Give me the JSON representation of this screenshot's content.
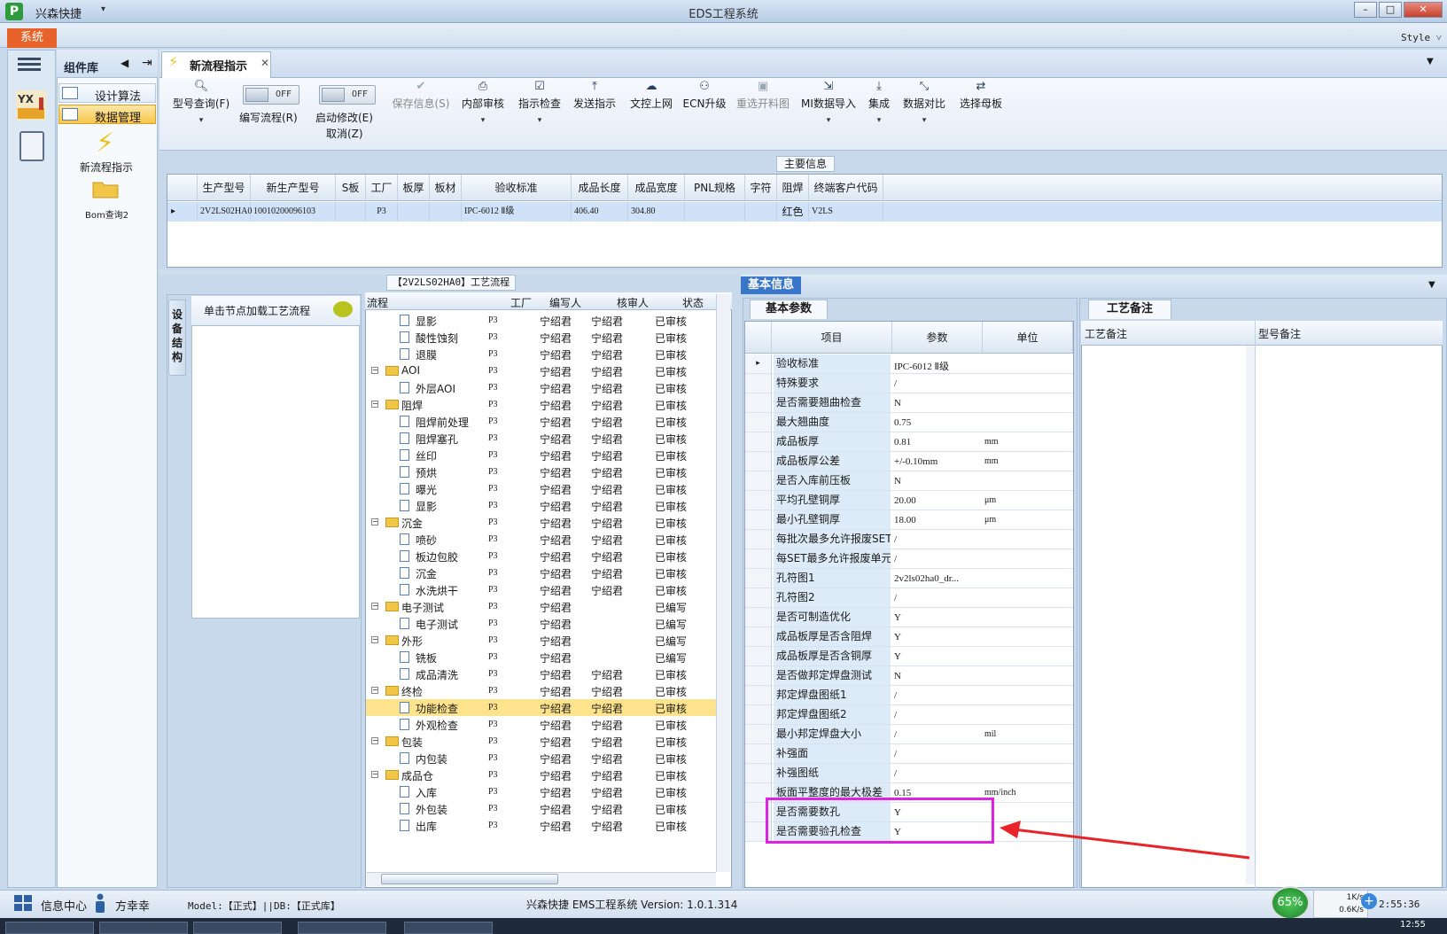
{
  "window": {
    "app_name": "兴森快捷",
    "title": "EDS工程系统",
    "minimize": "–",
    "maximize": "□",
    "close": "✕"
  },
  "menu": {
    "system_tab": "系统",
    "style_label": "Style ˅"
  },
  "component_library": {
    "title": "组件库",
    "items": [
      {
        "label": "设计算法",
        "selected": false
      },
      {
        "label": "数据管理",
        "selected": true
      }
    ],
    "new_flow_label": "新流程指示",
    "bom_label": "Bom查询2"
  },
  "doc_tab": {
    "label": "新流程指示",
    "close": "✕"
  },
  "toolbar": {
    "model_query": "型号查询(F)",
    "edit_flow_toggle": "OFF",
    "edit_flow": "编写流程(R)",
    "start_modify_toggle": "OFF",
    "start_modify": "启动修改(E)",
    "cancel": "取消(Z)",
    "save_info": "保存信息(S)",
    "internal_review": "内部审核",
    "instruction_check": "指示检查",
    "send_instruction": "发送指示",
    "upload_doc": "文控上网",
    "ecn_upgrade": "ECN升级",
    "reselect_cut": "重选开料图",
    "mi_import": "MI数据导入",
    "integrate": "集成",
    "data_compare": "数据对比",
    "select_mother": "选择母板"
  },
  "main_info": {
    "legend": "主要信息",
    "columns": [
      "生产型号",
      "新生产型号",
      "S板",
      "工厂",
      "板厚",
      "板材",
      "验收标准",
      "成品长度",
      "成品宽度",
      "PNL规格",
      "字符",
      "阻焊",
      "终端客户代码"
    ],
    "row": {
      "prod_model": "2V2LS02HA0",
      "new_prod_model": "10010200096103",
      "s_board": "",
      "factory": "P3",
      "thickness": "",
      "material": "",
      "standard": "IPC-6012 Ⅱ级",
      "length": "406.40",
      "width": "304.80",
      "pnl": "",
      "char": "",
      "solder_mask": "红色",
      "customer_code": "V2LS"
    }
  },
  "device_panel": {
    "vertical_tab": "设备结构",
    "hint": "单击节点加载工艺流程"
  },
  "process": {
    "legend": "【2V2LS02HA0】工艺流程",
    "columns": [
      "流程",
      "工厂",
      "编写人",
      "核审人",
      "状态"
    ],
    "rows": [
      {
        "name": "显影",
        "level": 2,
        "factory": "P3",
        "writer": "宁绍君",
        "reviewer": "宁绍君",
        "status": "已审核"
      },
      {
        "name": "酸性蚀刻",
        "level": 2,
        "factory": "P3",
        "writer": "宁绍君",
        "reviewer": "宁绍君",
        "status": "已审核"
      },
      {
        "name": "退膜",
        "level": 2,
        "factory": "P3",
        "writer": "宁绍君",
        "reviewer": "宁绍君",
        "status": "已审核"
      },
      {
        "name": "AOI",
        "level": 1,
        "factory": "P3",
        "writer": "宁绍君",
        "reviewer": "宁绍君",
        "status": "已审核"
      },
      {
        "name": "外层AOI",
        "level": 2,
        "factory": "P3",
        "writer": "宁绍君",
        "reviewer": "宁绍君",
        "status": "已审核"
      },
      {
        "name": "阻焊",
        "level": 1,
        "factory": "P3",
        "writer": "宁绍君",
        "reviewer": "宁绍君",
        "status": "已审核"
      },
      {
        "name": "阻焊前处理",
        "level": 2,
        "factory": "P3",
        "writer": "宁绍君",
        "reviewer": "宁绍君",
        "status": "已审核"
      },
      {
        "name": "阻焊塞孔",
        "level": 2,
        "factory": "P3",
        "writer": "宁绍君",
        "reviewer": "宁绍君",
        "status": "已审核"
      },
      {
        "name": "丝印",
        "level": 2,
        "factory": "P3",
        "writer": "宁绍君",
        "reviewer": "宁绍君",
        "status": "已审核"
      },
      {
        "name": "预烘",
        "level": 2,
        "factory": "P3",
        "writer": "宁绍君",
        "reviewer": "宁绍君",
        "status": "已审核"
      },
      {
        "name": "曝光",
        "level": 2,
        "factory": "P3",
        "writer": "宁绍君",
        "reviewer": "宁绍君",
        "status": "已审核"
      },
      {
        "name": "显影",
        "level": 2,
        "factory": "P3",
        "writer": "宁绍君",
        "reviewer": "宁绍君",
        "status": "已审核"
      },
      {
        "name": "沉金",
        "level": 1,
        "factory": "P3",
        "writer": "宁绍君",
        "reviewer": "宁绍君",
        "status": "已审核"
      },
      {
        "name": "喷砂",
        "level": 2,
        "factory": "P3",
        "writer": "宁绍君",
        "reviewer": "宁绍君",
        "status": "已审核"
      },
      {
        "name": "板边包胶",
        "level": 2,
        "factory": "P3",
        "writer": "宁绍君",
        "reviewer": "宁绍君",
        "status": "已审核"
      },
      {
        "name": "沉金",
        "level": 2,
        "factory": "P3",
        "writer": "宁绍君",
        "reviewer": "宁绍君",
        "status": "已审核"
      },
      {
        "name": "水洗烘干",
        "level": 2,
        "factory": "P3",
        "writer": "宁绍君",
        "reviewer": "宁绍君",
        "status": "已审核"
      },
      {
        "name": "电子测试",
        "level": 1,
        "factory": "P3",
        "writer": "宁绍君",
        "reviewer": "",
        "status": "已编写"
      },
      {
        "name": "电子测试",
        "level": 2,
        "factory": "P3",
        "writer": "宁绍君",
        "reviewer": "",
        "status": "已编写"
      },
      {
        "name": "外形",
        "level": 1,
        "factory": "P3",
        "writer": "宁绍君",
        "reviewer": "",
        "status": "已编写"
      },
      {
        "name": "铣板",
        "level": 2,
        "factory": "P3",
        "writer": "宁绍君",
        "reviewer": "",
        "status": "已编写"
      },
      {
        "name": "成品清洗",
        "level": 2,
        "factory": "P3",
        "writer": "宁绍君",
        "reviewer": "宁绍君",
        "status": "已审核"
      },
      {
        "name": "终检",
        "level": 1,
        "factory": "P3",
        "writer": "宁绍君",
        "reviewer": "宁绍君",
        "status": "已审核"
      },
      {
        "name": "功能检查",
        "level": 2,
        "factory": "P3",
        "writer": "宁绍君",
        "reviewer": "宁绍君",
        "status": "已审核",
        "selected": true
      },
      {
        "name": "外观检查",
        "level": 2,
        "factory": "P3",
        "writer": "宁绍君",
        "reviewer": "宁绍君",
        "status": "已审核"
      },
      {
        "name": "包装",
        "level": 1,
        "factory": "P3",
        "writer": "宁绍君",
        "reviewer": "宁绍君",
        "status": "已审核"
      },
      {
        "name": "内包装",
        "level": 2,
        "factory": "P3",
        "writer": "宁绍君",
        "reviewer": "宁绍君",
        "status": "已审核"
      },
      {
        "name": "成品仓",
        "level": 1,
        "factory": "P3",
        "writer": "宁绍君",
        "reviewer": "宁绍君",
        "status": "已审核"
      },
      {
        "name": "入库",
        "level": 2,
        "factory": "P3",
        "writer": "宁绍君",
        "reviewer": "宁绍君",
        "status": "已审核"
      },
      {
        "name": "外包装",
        "level": 2,
        "factory": "P3",
        "writer": "宁绍君",
        "reviewer": "宁绍君",
        "status": "已审核"
      },
      {
        "name": "出库",
        "level": 2,
        "factory": "P3",
        "writer": "宁绍君",
        "reviewer": "宁绍君",
        "status": "已审核"
      }
    ]
  },
  "basic_info": {
    "tab": "基本信息",
    "params_tab": "基本参数",
    "columns": [
      "项目",
      "参数",
      "单位"
    ],
    "rows": [
      {
        "item": "验收标准",
        "value": "IPC-6012 Ⅱ级",
        "unit": "",
        "current": true
      },
      {
        "item": "特殊要求",
        "value": "/",
        "unit": ""
      },
      {
        "item": "是否需要翘曲检查",
        "value": "N",
        "unit": ""
      },
      {
        "item": "最大翘曲度",
        "value": "0.75",
        "unit": ""
      },
      {
        "item": "成品板厚",
        "value": "0.81",
        "unit": "mm"
      },
      {
        "item": "成品板厚公差",
        "value": "+/-0.10mm",
        "unit": "mm"
      },
      {
        "item": "是否入库前压板",
        "value": "N",
        "unit": ""
      },
      {
        "item": "平均孔壁铜厚",
        "value": "20.00",
        "unit": "μm"
      },
      {
        "item": "最小孔壁铜厚",
        "value": "18.00",
        "unit": "μm"
      },
      {
        "item": "每批次最多允许报废SET",
        "value": "/",
        "unit": ""
      },
      {
        "item": "每SET最多允许报废单元",
        "value": "/",
        "unit": ""
      },
      {
        "item": "孔符图1",
        "value": "2v2ls02ha0_dr...",
        "unit": ""
      },
      {
        "item": "孔符图2",
        "value": "/",
        "unit": ""
      },
      {
        "item": "是否可制造优化",
        "value": "Y",
        "unit": ""
      },
      {
        "item": "成品板厚是否含阻焊",
        "value": "Y",
        "unit": ""
      },
      {
        "item": "成品板厚是否含铜厚",
        "value": "Y",
        "unit": ""
      },
      {
        "item": "是否做邦定焊盘测试",
        "value": "N",
        "unit": ""
      },
      {
        "item": "邦定焊盘图纸1",
        "value": "/",
        "unit": ""
      },
      {
        "item": "邦定焊盘图纸2",
        "value": "/",
        "unit": ""
      },
      {
        "item": "最小邦定焊盘大小",
        "value": "/",
        "unit": "mil"
      },
      {
        "item": "补强面",
        "value": "/",
        "unit": ""
      },
      {
        "item": "补强图纸",
        "value": "/",
        "unit": ""
      },
      {
        "item": "板面平整度的最大极差",
        "value": "0.15",
        "unit": "mm/inch"
      },
      {
        "item": "是否需要数孔",
        "value": "Y",
        "unit": ""
      },
      {
        "item": "是否需要验孔检查",
        "value": "Y",
        "unit": ""
      }
    ]
  },
  "notes": {
    "tab": "工艺备注",
    "col1": "工艺备注",
    "col2": "型号备注"
  },
  "annotation": {
    "highlight_color": "#e022e3",
    "arrow_color": "#e8232a"
  },
  "status_bar": {
    "info_center": "信息中心",
    "user": "方幸幸",
    "model_db": "Model:【正式】||DB:【正式库】",
    "version": "兴森快捷  EMS工程系统  Version: 1.0.1.314",
    "cpu_percent": "65%",
    "upload_speed": "1K/s",
    "download_speed": "0.6K/s",
    "time": "2:55:36",
    "clock": "12:55"
  },
  "colors": {
    "accent": "#3a76c8",
    "system_tab": "#e8632b",
    "selected_row": "#fde38c"
  }
}
